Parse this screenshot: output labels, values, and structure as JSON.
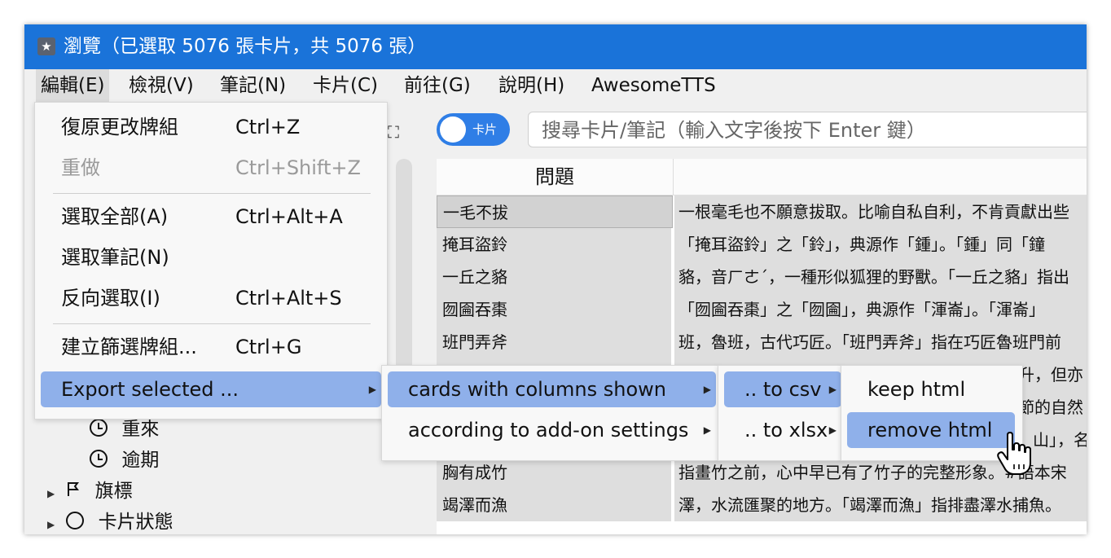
{
  "window": {
    "title": "瀏覽（已選取 5076 張卡片，共 5076 張）",
    "accent_color": "#1a73d9"
  },
  "menubar": {
    "items": [
      {
        "label": "編輯(E)"
      },
      {
        "label": "檢視(V)"
      },
      {
        "label": "筆記(N)"
      },
      {
        "label": "卡片(C)"
      },
      {
        "label": "前往(G)"
      },
      {
        "label": "說明(H)"
      },
      {
        "label": "AwesomeTTS"
      }
    ]
  },
  "edit_menu": {
    "undo": {
      "label": "復原更改牌組",
      "shortcut": "Ctrl+Z"
    },
    "redo": {
      "label": "重做",
      "shortcut": "Ctrl+Shift+Z"
    },
    "select_all": {
      "label": "選取全部(A)",
      "shortcut": "Ctrl+Alt+A"
    },
    "select_notes": {
      "label": "選取筆記(N)",
      "shortcut": ""
    },
    "invert_selection": {
      "label": "反向選取(I)",
      "shortcut": "Ctrl+Alt+S"
    },
    "create_filtered_deck": {
      "label": "建立篩選牌組...",
      "shortcut": "Ctrl+G"
    },
    "export_selected": {
      "label": "Export selected ..."
    }
  },
  "export_submenu": {
    "columns_shown": "cards with columns shown",
    "addon_settings": "according to add-on settings"
  },
  "format_submenu": {
    "csv": ".. to csv",
    "xlsx": ".. to xlsx"
  },
  "html_submenu": {
    "keep": "keep html",
    "remove": "remove html"
  },
  "sidebar": {
    "items": [
      {
        "label": "重來",
        "icon": "clock-icon"
      },
      {
        "label": "逾期",
        "icon": "clock-icon"
      },
      {
        "label": "旗標",
        "icon": "flag-icon"
      },
      {
        "label": "卡片狀態",
        "icon": "circle-icon"
      }
    ]
  },
  "toolbar": {
    "toggle_label": "卡片",
    "search_placeholder": "搜尋卡片/筆記（輸入文字後按下 Enter 鍵）"
  },
  "table": {
    "columns": [
      "問題"
    ],
    "rows": [
      {
        "question": "一毛不拔",
        "answer": "一根毫毛也不願意拔取。比喻自私自利，不肯貢獻出些"
      },
      {
        "question": "掩耳盜鈴",
        "answer": "「掩耳盜鈴」之「鈴」，典源作「鍾」。「鍾」同「鐘"
      },
      {
        "question": "一丘之貉",
        "answer": "貉，音ㄏㄜˊ，一種形似狐狸的野獸。「一丘之貉」指出"
      },
      {
        "question": "囫圇吞棗",
        "answer": "「囫圇吞棗」之「囫圇」，典源作「渾崙」。「渾崙」"
      },
      {
        "question": "班門弄斧",
        "answer": "班，魯班，古代巧匠。「班門弄斧」指在巧匠魯班門前"
      },
      {
        "question": "",
        "answer": "升，但亦"
      },
      {
        "question": "",
        "answer": "節的自然"
      },
      {
        "question": "",
        "answer": "山」，名"
      },
      {
        "question": "胸有成竹",
        "answer": "指畫竹之前，心中早已有了竹子的完整形象。#語本宋"
      },
      {
        "question": "竭澤而漁",
        "answer": "澤，水流匯聚的地方。「竭澤而漁」指排盡澤水捕魚。"
      }
    ]
  }
}
